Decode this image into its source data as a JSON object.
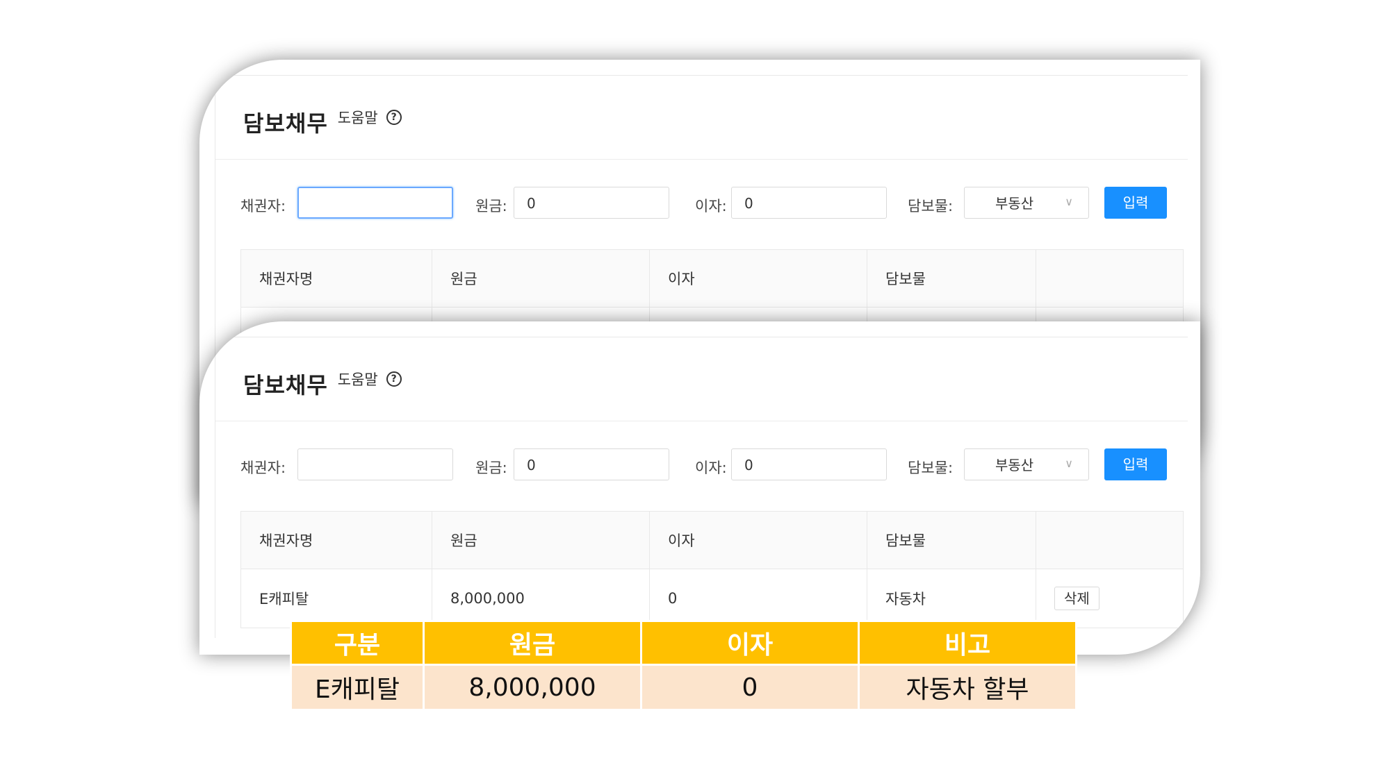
{
  "panel": {
    "title": "담보채무",
    "help_label": "도움말",
    "help_icon": "?",
    "form": {
      "creditor_label": "채권자:",
      "creditor_value": "",
      "principal_label": "원금:",
      "principal_value": "0",
      "interest_label": "이자:",
      "interest_value": "0",
      "collateral_label": "담보물:",
      "collateral_value": "부동산",
      "chevron": "∨",
      "submit_label": "입력"
    },
    "table": {
      "headers": [
        "채권자명",
        "원금",
        "이자",
        "담보물",
        ""
      ],
      "rows": [
        {
          "creditor": "E캐피탈",
          "principal": "8,000,000",
          "interest": "0",
          "collateral": "자동차",
          "action": "삭제"
        }
      ]
    }
  },
  "summary": {
    "headers": [
      "구분",
      "원금",
      "이자",
      "비고"
    ],
    "row": [
      "E캐피탈",
      "8,000,000",
      "0",
      "자동차 할부"
    ]
  },
  "colors": {
    "primary": "#1890ff",
    "summary_header": "#ffc000",
    "summary_cell": "#fce4cc"
  }
}
